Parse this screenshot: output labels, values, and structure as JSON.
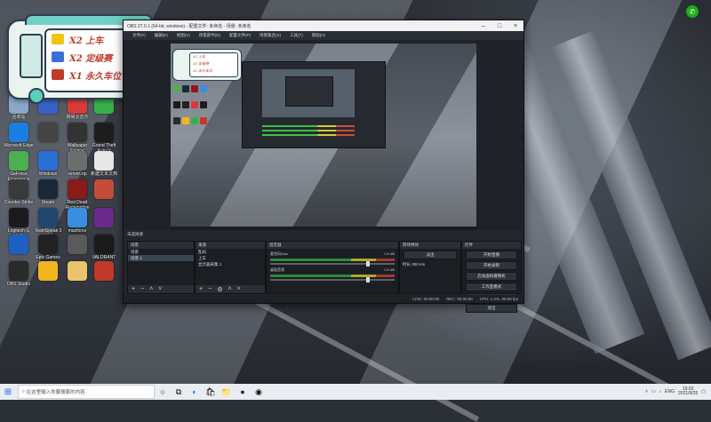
{
  "bus_overlay": {
    "rows": [
      {
        "text": "X2 上车",
        "badge_color": "#f1c40f"
      },
      {
        "text": "X2 定级赛",
        "badge_color": "#3a6fd8"
      },
      {
        "text": "X1 永久车位",
        "badge_color": "#c0392b"
      }
    ]
  },
  "desktop_icons": [
    {
      "label": "回收站",
      "color": "#8aa6c8"
    },
    {
      "label": "Microsoft Edge",
      "color": "#1a7ee0"
    },
    {
      "label": "GeForce Experience",
      "color": "#4caf50"
    },
    {
      "label": "Counter-Strike",
      "color": "#3a3a3a"
    },
    {
      "label": "Logitech G HUB",
      "color": "#1b1b1b"
    },
    {
      "label": "",
      "color": "#1e5fbf"
    },
    {
      "label": "OBS Studio",
      "color": "#2a2a2a"
    },
    {
      "label": "",
      "color": "#3563c9"
    },
    {
      "label": "",
      "color": "#444"
    },
    {
      "label": "Windows",
      "color": "#2a6fd6"
    },
    {
      "label": "Steam",
      "color": "#1b2838"
    },
    {
      "label": "TeamSpeak 3",
      "color": "#23466f"
    },
    {
      "label": "Epic Games Launcher",
      "color": "#222"
    },
    {
      "label": "",
      "color": "#f2b51e"
    },
    {
      "label": "网易云音乐",
      "color": "#d93a3a"
    },
    {
      "label": "Wallpaper Engine",
      "color": "#333"
    },
    {
      "label": "server.zip",
      "color": "#6d6d6d"
    },
    {
      "label": "Red Dead Redemption",
      "color": "#8b1a1a"
    },
    {
      "label": "macforce",
      "color": "#3a8ee0"
    },
    {
      "label": "",
      "color": "#5a5a5a"
    },
    {
      "label": "",
      "color": "#e9c46a"
    },
    {
      "label": "",
      "color": "#38b04a"
    },
    {
      "label": "Grand Theft Auto V",
      "color": "#1d1d1d"
    },
    {
      "label": "新建文本文档",
      "color": "#e8e8e8"
    },
    {
      "label": "",
      "color": "#c74b3b"
    },
    {
      "label": "",
      "color": "#6a2a8a"
    },
    {
      "label": "VALORANT",
      "color": "#1b1b1b"
    },
    {
      "label": "",
      "color": "#c0392b"
    }
  ],
  "obs": {
    "title": "OBS 27.0.1 (64-bit, windows) - 配置文件: 未命名 - 场景: 未命名",
    "menu": [
      "文件(F)",
      "编辑(E)",
      "视图(V)",
      "停靠部件(D)",
      "配置文件(P)",
      "场景集合(S)",
      "工具(T)",
      "帮助(H)"
    ],
    "dock_label": "未选择源",
    "scenes": {
      "title": "场景",
      "items": [
        "场景",
        "场景 2"
      ]
    },
    "sources": {
      "title": "来源",
      "items": [
        "乱码",
        "上车",
        "显示器采集 1"
      ]
    },
    "mixer": {
      "title": "混音器",
      "tracks": [
        {
          "name": "麦克风/Aux",
          "level": "0.0 dB"
        },
        {
          "name": "桌面音频",
          "level": "0.0 dB"
        }
      ]
    },
    "transitions": {
      "title": "转场特效",
      "type": "淡出",
      "duration_label": "时长",
      "duration": "300 ms"
    },
    "controls": {
      "title": "控件",
      "buttons": [
        "开始直播",
        "开始录制",
        "启动虚拟摄像机",
        "工作室模式",
        "设置",
        "退出"
      ]
    },
    "status": [
      "LIVE: 00:00:00",
      "REC: 00:00:00",
      "CPU: 1.2%, 60.00 fps"
    ]
  },
  "taskbar": {
    "search_placeholder": "在这里输入你要搜索的内容",
    "apps": [
      "○",
      "⧉",
      "◐",
      "🛍",
      "📁",
      "●",
      "◉"
    ],
    "lang": "ENG",
    "time": "19:03",
    "date": "2021/9/25"
  }
}
